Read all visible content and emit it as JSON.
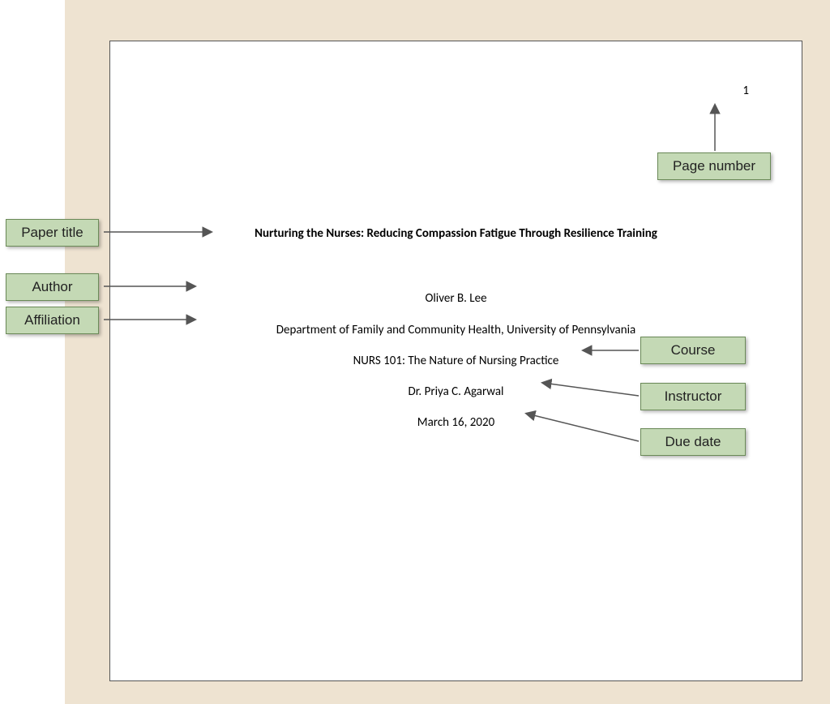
{
  "document": {
    "page_number": "1",
    "title": "Nurturing the Nurses: Reducing Compassion Fatigue Through Resilience Training",
    "author": "Oliver B. Lee",
    "affiliation": "Department of Family and Community Health, University of Pennsylvania",
    "course": "NURS 101: The Nature of Nursing Practice",
    "instructor": "Dr. Priya C. Agarwal",
    "due_date": "March 16, 2020"
  },
  "labels": {
    "paper_title": "Paper title",
    "author": "Author",
    "affiliation": "Affiliation",
    "page_number": "Page number",
    "course": "Course",
    "instructor": "Instructor",
    "due_date": "Due date"
  }
}
